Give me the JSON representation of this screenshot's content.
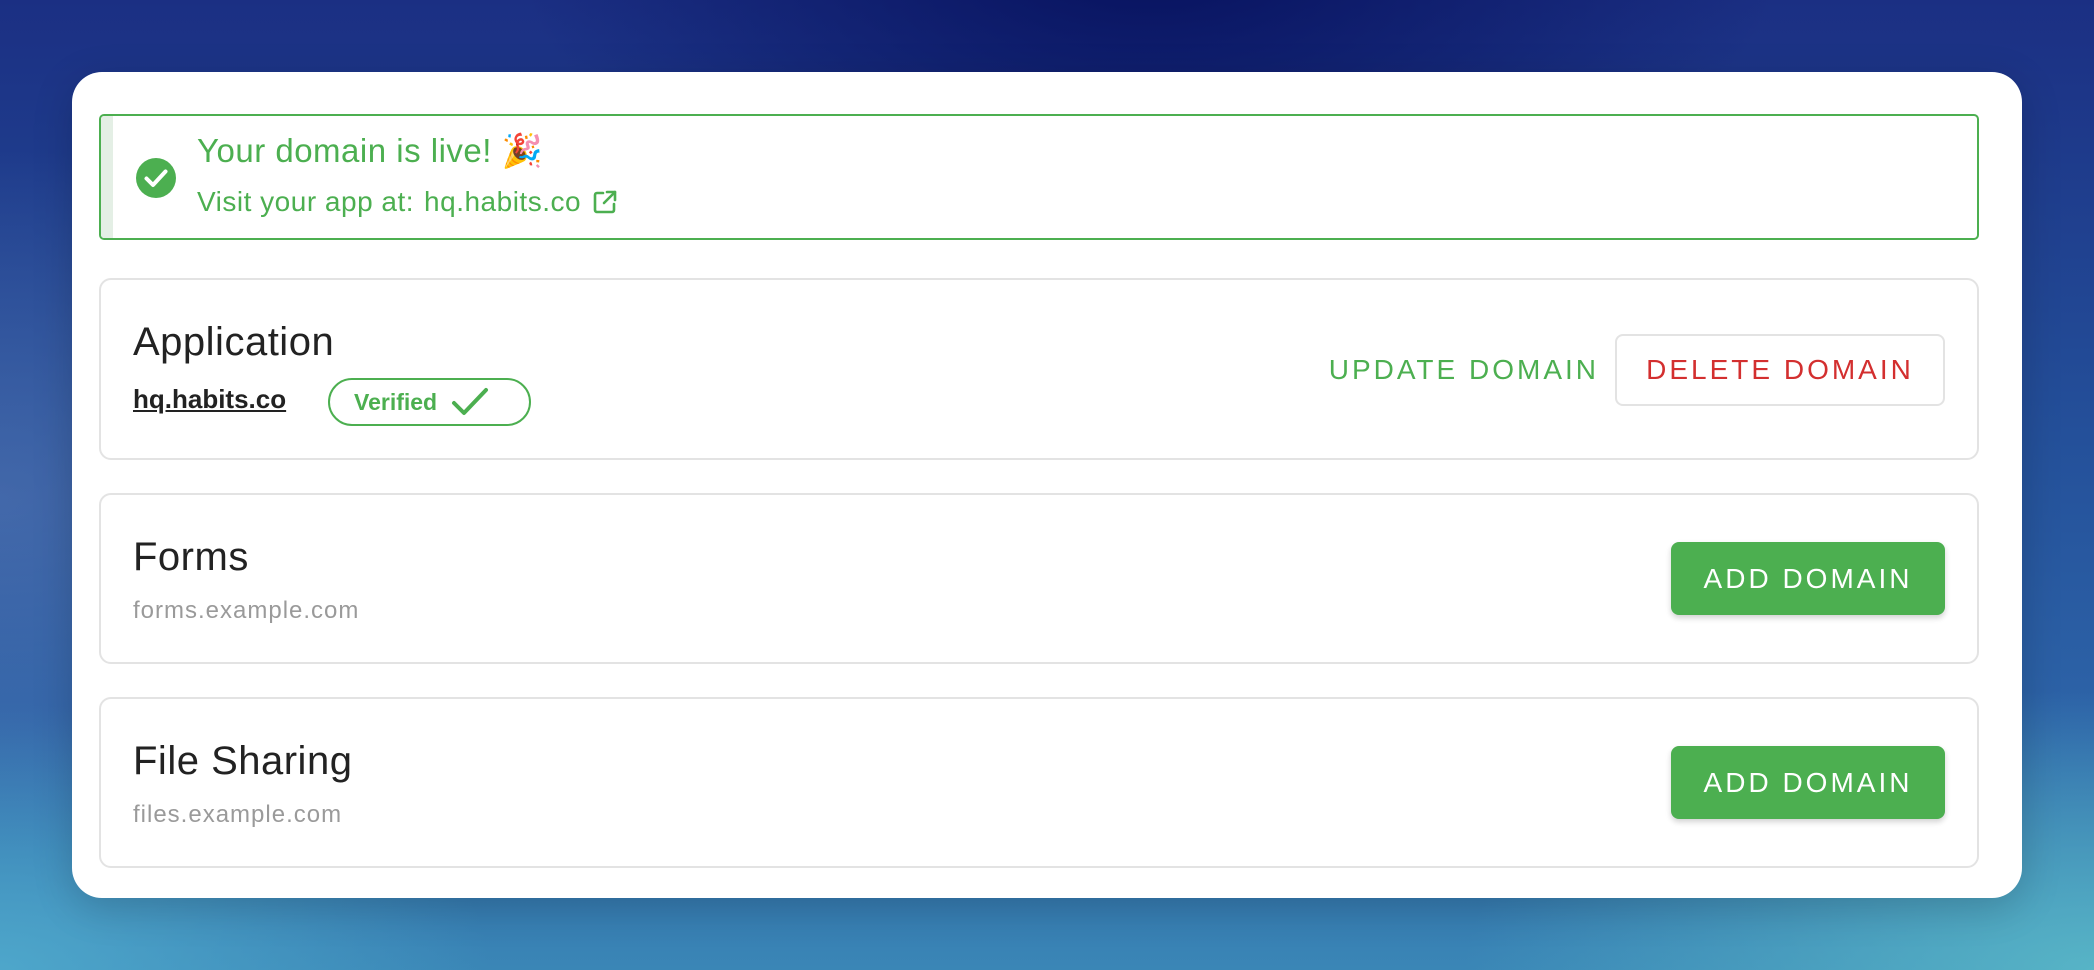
{
  "alert": {
    "title": "Your domain is live! 🎉",
    "visit_prefix": "Visit your app at:",
    "visit_link": "hq.habits.co",
    "icons": {
      "status": "check-circle-icon",
      "external": "external-link-icon"
    }
  },
  "sections": {
    "application": {
      "title": "Application",
      "domain": "hq.habits.co",
      "badge": "Verified",
      "update_button": "UPDATE DOMAIN",
      "delete_button": "DELETE DOMAIN"
    },
    "forms": {
      "title": "Forms",
      "placeholder": "forms.example.com",
      "add_button": "ADD DOMAIN"
    },
    "files": {
      "title": "File Sharing",
      "placeholder": "files.example.com",
      "add_button": "ADD DOMAIN"
    }
  },
  "colors": {
    "success": "#4caf50",
    "danger": "#d32f2f",
    "text": "#222222",
    "muted": "#9a9a9a"
  }
}
